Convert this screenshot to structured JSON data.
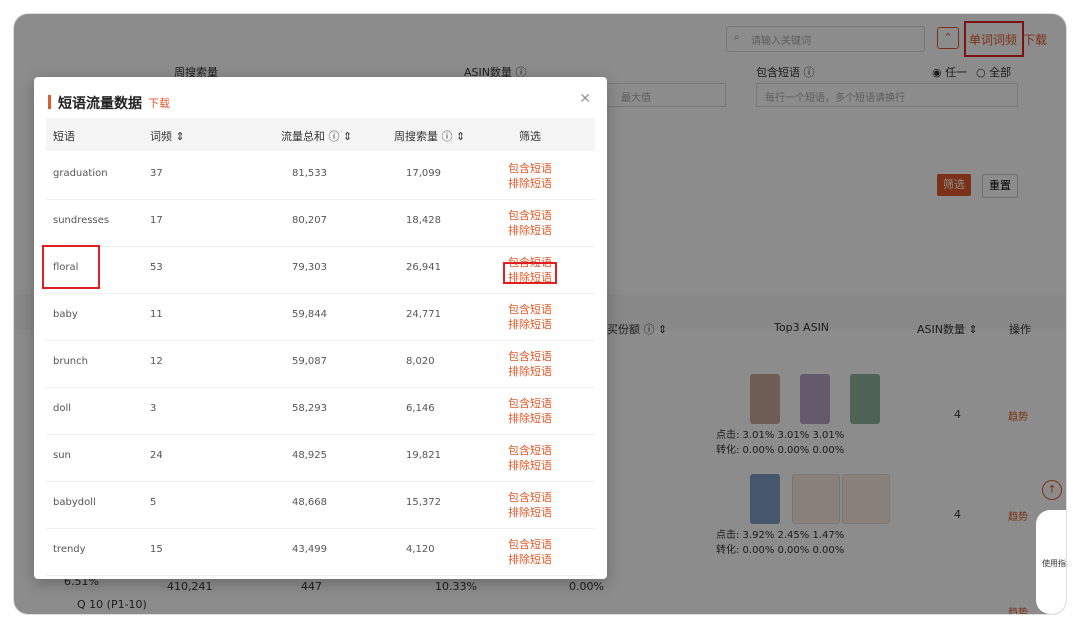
{
  "background": {
    "search_placeholder": "请输入关键词",
    "word_freq_btn": "单词词频",
    "download": "下载",
    "labels": {
      "weekly_search": "周搜索量",
      "asin_count": "ASIN数量 ⓘ",
      "contains_phrase": "包含短语 ⓘ",
      "any": "◉ 任一",
      "all": "○ 全部"
    },
    "max_placeholder": "最大值",
    "phrase_placeholder": "每行一个短语，多个短语请换行",
    "filter": "筛选",
    "reset": "重置",
    "headers": {
      "sales_share": "买份额 ⓘ ⇕",
      "top3": "Top3 ASIN",
      "asin_count": "ASIN数量 ⇕",
      "actions": "操作"
    },
    "row1": {
      "click": "点击: 3.01%  3.01%  3.01%",
      "conv": "转化: 0.00%  0.00%  0.00%",
      "count": "4",
      "trend": "趋势"
    },
    "row2": {
      "click": "点击: 3.92%  2.45%  1.47%",
      "conv": "转化: 0.00%  0.00%  0.00%",
      "count": "4",
      "trend": "趋势"
    },
    "row3": {
      "pct": "6.51%",
      "rank": "Q 10 (P1-10)",
      "search": "410,241",
      "asin": "447",
      "rate": "10.33%",
      "share": "0.00%",
      "trend": "趋势"
    }
  },
  "side": {
    "guide": "使用指"
  },
  "modal": {
    "title": "短语流量数据",
    "download": "下载",
    "columns": [
      "短语",
      "词频 ⇕",
      "流量总和 ⓘ ⇕",
      "周搜索量 ⓘ ⇕",
      "筛选"
    ],
    "include": "包含短语",
    "exclude": "排除短语",
    "rows": [
      {
        "phrase": "graduation",
        "freq": "37",
        "traffic": "81,533",
        "search": "17,099"
      },
      {
        "phrase": "sundresses",
        "freq": "17",
        "traffic": "80,207",
        "search": "18,428"
      },
      {
        "phrase": "floral",
        "freq": "53",
        "traffic": "79,303",
        "search": "26,941"
      },
      {
        "phrase": "baby",
        "freq": "11",
        "traffic": "59,844",
        "search": "24,771"
      },
      {
        "phrase": "brunch",
        "freq": "12",
        "traffic": "59,087",
        "search": "8,020"
      },
      {
        "phrase": "doll",
        "freq": "3",
        "traffic": "58,293",
        "search": "6,146"
      },
      {
        "phrase": "sun",
        "freq": "24",
        "traffic": "48,925",
        "search": "19,821"
      },
      {
        "phrase": "babydoll",
        "freq": "5",
        "traffic": "48,668",
        "search": "15,372"
      },
      {
        "phrase": "trendy",
        "freq": "15",
        "traffic": "43,499",
        "search": "4,120"
      }
    ]
  }
}
